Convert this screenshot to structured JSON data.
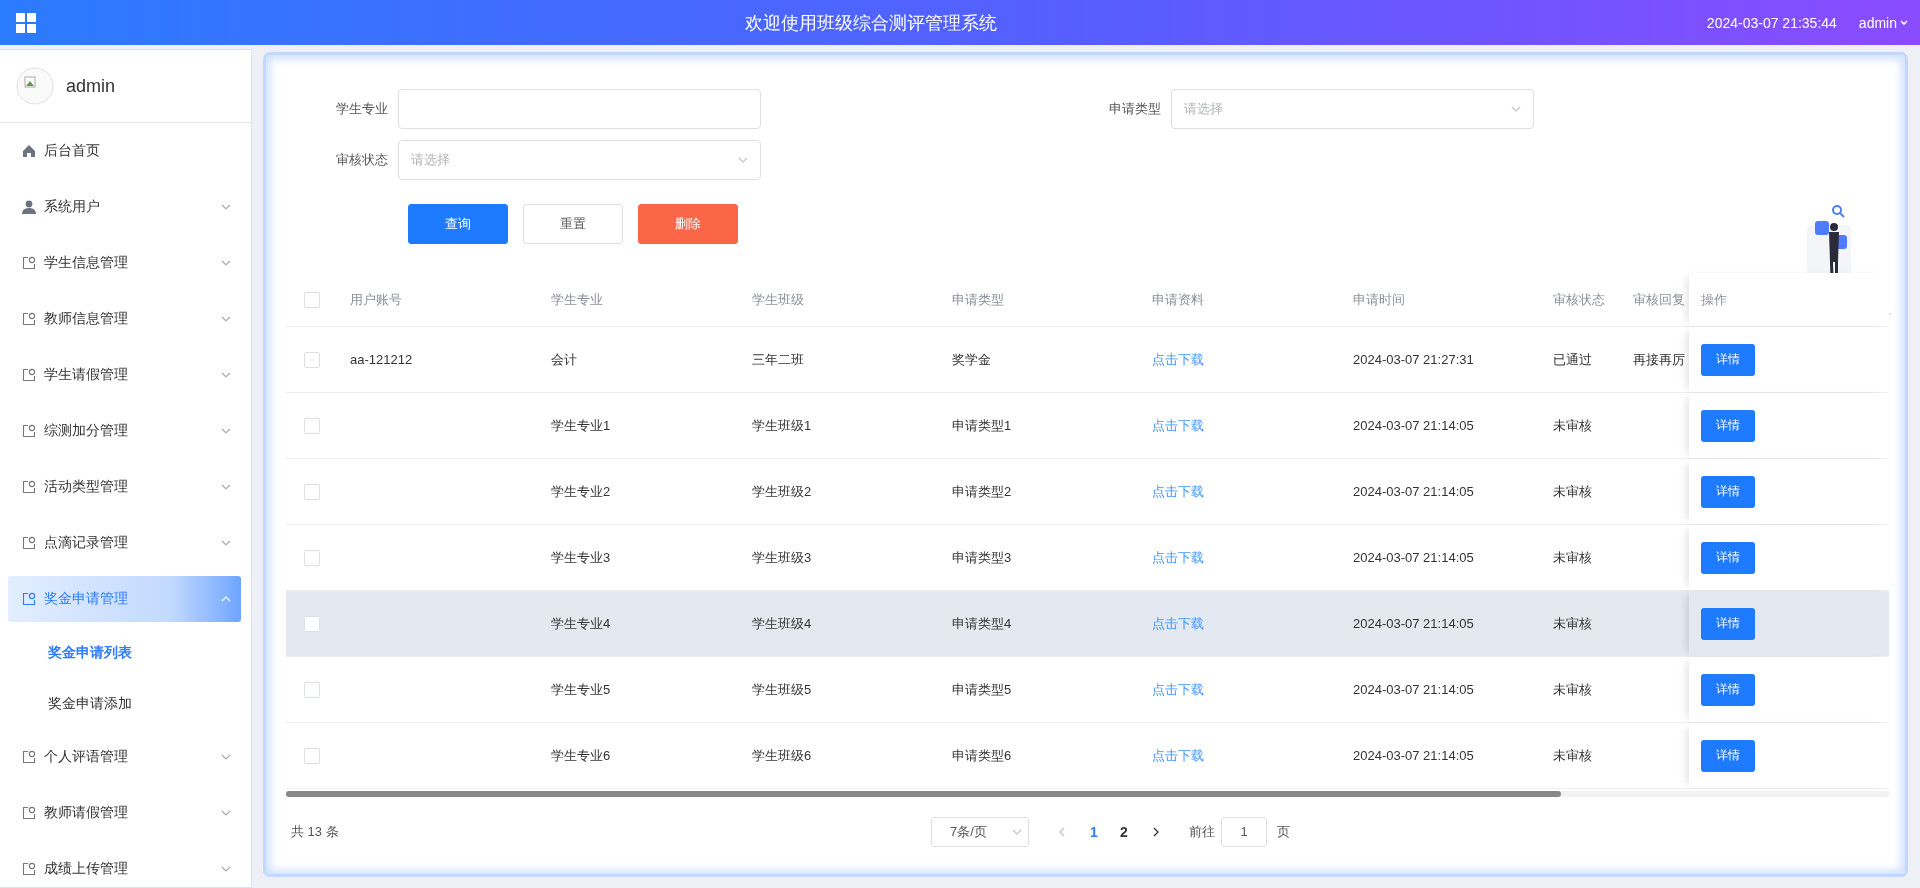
{
  "header": {
    "title": "欢迎使用班级综合测评管理系统",
    "datetime": "2024-03-07 21:35:44",
    "user": "admin"
  },
  "sidebar": {
    "user": "admin",
    "items": [
      {
        "label": "后台首页",
        "kind": "home",
        "selected": false
      },
      {
        "label": "系统用户",
        "kind": "user",
        "expanded": false,
        "selected": false
      },
      {
        "label": "学生信息管理",
        "kind": "module",
        "expanded": false,
        "selected": false
      },
      {
        "label": "教师信息管理",
        "kind": "module",
        "expanded": false,
        "selected": false
      },
      {
        "label": "学生请假管理",
        "kind": "module",
        "expanded": false,
        "selected": false
      },
      {
        "label": "综测加分管理",
        "kind": "module",
        "expanded": false,
        "selected": false
      },
      {
        "label": "活动类型管理",
        "kind": "module",
        "expanded": false,
        "selected": false
      },
      {
        "label": "点滴记录管理",
        "kind": "module",
        "expanded": false,
        "selected": false
      },
      {
        "label": "奖金申请管理",
        "kind": "module",
        "expanded": true,
        "selected": true,
        "children": [
          {
            "label": "奖金申请列表",
            "selected": true
          },
          {
            "label": "奖金申请添加",
            "selected": false
          }
        ]
      },
      {
        "label": "个人评语管理",
        "kind": "module",
        "expanded": false,
        "selected": false
      },
      {
        "label": "教师请假管理",
        "kind": "module",
        "expanded": false,
        "selected": false
      },
      {
        "label": "成绩上传管理",
        "kind": "module",
        "expanded": false,
        "selected": false
      }
    ]
  },
  "filters": [
    {
      "label": "学生专业",
      "kind": "text"
    },
    {
      "label": "申请类型",
      "kind": "select",
      "placeholder": "请选择"
    },
    {
      "label": "审核状态",
      "kind": "select",
      "placeholder": "请选择"
    }
  ],
  "buttons": [
    {
      "label": "查询",
      "kind": "primary"
    },
    {
      "label": "重置",
      "kind": "default"
    },
    {
      "label": "删除",
      "kind": "danger"
    }
  ],
  "table": {
    "all_checked": false,
    "columns": [
      "用户账号",
      "学生专业",
      "学生班级",
      "申请类型",
      "申请资料",
      "申请时间",
      "审核状态",
      "审核回复",
      "操作"
    ],
    "rows": [
      {
        "checked": false,
        "hovered": false,
        "cells": [
          "aa-121212",
          "会计",
          "三年二班",
          "奖学金",
          "点击下载",
          "2024-03-07 21:27:31",
          "已通过",
          "再接再厉"
        ],
        "action": "详情"
      },
      {
        "checked": false,
        "hovered": false,
        "cells": [
          "",
          "学生专业1",
          "学生班级1",
          "申请类型1",
          "点击下载",
          "2024-03-07 21:14:05",
          "未审核",
          ""
        ],
        "action": "详情"
      },
      {
        "checked": false,
        "hovered": false,
        "cells": [
          "",
          "学生专业2",
          "学生班级2",
          "申请类型2",
          "点击下载",
          "2024-03-07 21:14:05",
          "未审核",
          ""
        ],
        "action": "详情"
      },
      {
        "checked": false,
        "hovered": false,
        "cells": [
          "",
          "学生专业3",
          "学生班级3",
          "申请类型3",
          "点击下载",
          "2024-03-07 21:14:05",
          "未审核",
          ""
        ],
        "action": "详情"
      },
      {
        "checked": false,
        "hovered": true,
        "cells": [
          "",
          "学生专业4",
          "学生班级4",
          "申请类型4",
          "点击下载",
          "2024-03-07 21:14:05",
          "未审核",
          ""
        ],
        "action": "详情"
      },
      {
        "checked": false,
        "hovered": false,
        "cells": [
          "",
          "学生专业5",
          "学生班级5",
          "申请类型5",
          "点击下载",
          "2024-03-07 21:14:05",
          "未审核",
          ""
        ],
        "action": "详情"
      },
      {
        "checked": false,
        "hovered": false,
        "cells": [
          "",
          "学生专业6",
          "学生班级6",
          "申请类型6",
          "点击下载",
          "2024-03-07 21:14:05",
          "未审核",
          ""
        ],
        "action": "详情"
      }
    ]
  },
  "pagination": {
    "total": "共 13 条",
    "page_size": "7条/页",
    "pages": [
      {
        "label": "1",
        "selected": true
      },
      {
        "label": "2",
        "selected": false
      }
    ],
    "goto_label": "前往",
    "goto_value": "1",
    "goto_suffix": "页"
  }
}
